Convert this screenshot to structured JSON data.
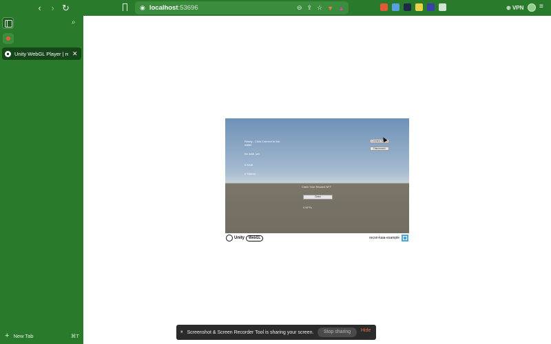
{
  "browser": {
    "url_host": "localhost",
    "url_port": ":53696",
    "vpn_label": "VPN",
    "nav": {
      "back": "‹",
      "forward": "›",
      "reload": "↻"
    }
  },
  "extensions": [
    {
      "name": "extension-red-icon",
      "color": "#e05a3a"
    },
    {
      "name": "extension-blue-icon",
      "color": "#5aa0e0"
    },
    {
      "name": "extension-dark-icon",
      "color": "#1d2a44"
    },
    {
      "name": "extension-yellow-icon",
      "color": "#e8d24a"
    },
    {
      "name": "extension-purple-icon",
      "color": "#3b3fa8"
    },
    {
      "name": "extension-gray-icon",
      "color": "#cfe5cf"
    }
  ],
  "sidebar": {
    "tab_title": "Unity WebGL Player | recov",
    "new_tab_label": "New Tab",
    "new_tab_shortcut": "⌘T"
  },
  "player": {
    "status_text": "Ready - Click Connect to link wallet",
    "no_address": "No addr. yet",
    "kaia_balance": "0 KAIA",
    "token_balance": "0 Tokens",
    "connect_button": "Connect Wallet",
    "disconnect_button": "Disconnect",
    "claim_prompt": "Claim Your Reward NFT",
    "claim_button": "Claim",
    "nft_count": "0 NFTs",
    "footer_project": "recon-kaia-example",
    "unity_word": "Unity",
    "webgl_word": "WebGL"
  },
  "share_bar": {
    "pause_icon": "⏸",
    "message": "Screenshot & Screen Recorder Tool is sharing your screen.",
    "stop_label": "Stop sharing",
    "hide_label": "Hide"
  }
}
